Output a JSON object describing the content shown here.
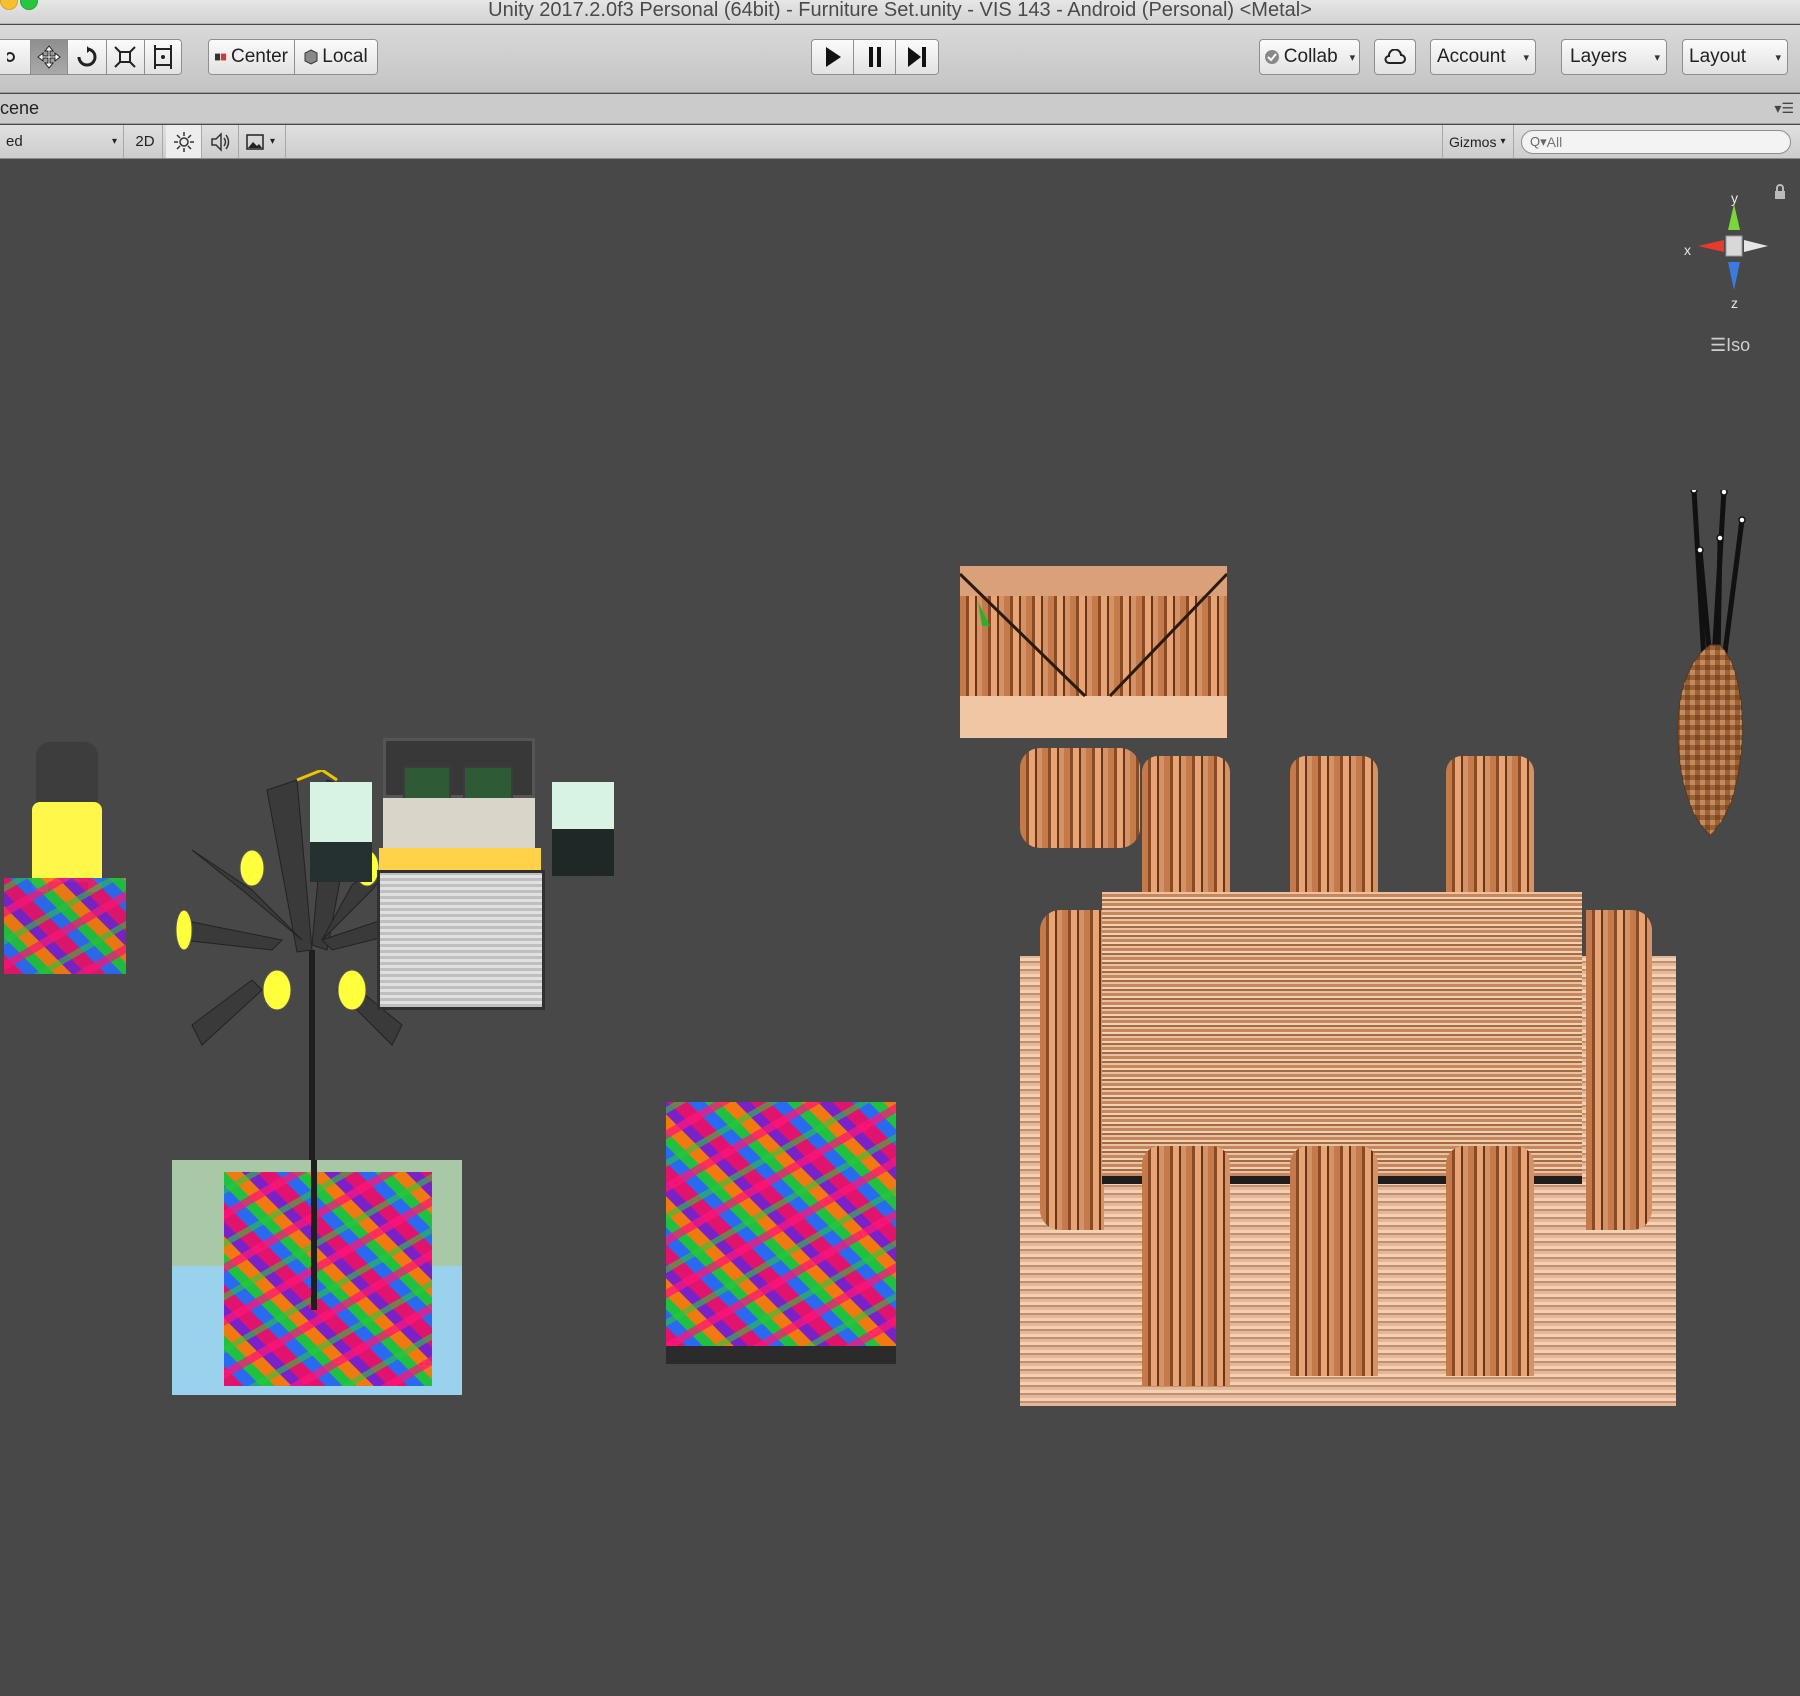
{
  "window": {
    "title": "Unity 2017.2.0f3 Personal (64bit) - Furniture Set.unity - VIS 143 - Android (Personal) <Metal>"
  },
  "toolbar": {
    "tools": [
      {
        "name": "hand-tool",
        "icon": "hand-icon"
      },
      {
        "name": "move-tool",
        "icon": "move-arrows-icon"
      },
      {
        "name": "rotate-tool",
        "icon": "rotate-icon"
      },
      {
        "name": "scale-tool",
        "icon": "scale-icon"
      },
      {
        "name": "rect-tool",
        "icon": "rect-icon"
      }
    ],
    "pivot_label": "Center",
    "space_label": "Local",
    "collab_label": "Collab",
    "account_label": "Account",
    "layers_label": "Layers",
    "layout_label": "Layout"
  },
  "scene_tab": {
    "label": "cene"
  },
  "scene_bar": {
    "shading_mode": "ed",
    "mode_2d": "2D",
    "gizmos_label": "Gizmos",
    "search_placeholder": "All"
  },
  "gizmo": {
    "axis_y": "y",
    "axis_x": "x",
    "axis_z": "z",
    "projection": "Iso",
    "colors": {
      "y": "#7bd63a",
      "x": "#e8392b",
      "z": "#3a7be0"
    }
  }
}
